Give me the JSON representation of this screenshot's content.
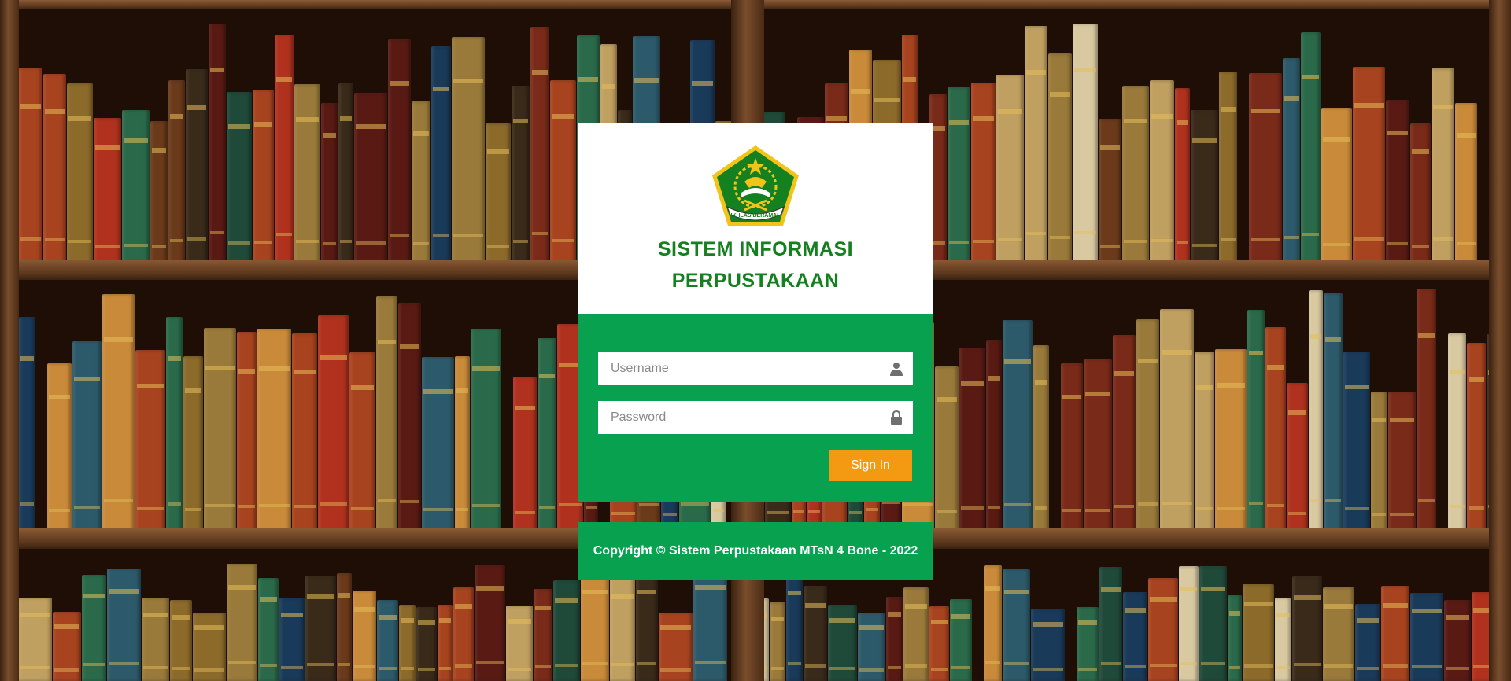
{
  "app": {
    "title_line1": "SISTEM INFORMASI",
    "title_line2": "PERPUSTAKAAN",
    "logo_icon": "kemenag-emblem-icon",
    "logo_text": "IKHLAS BERAMAL"
  },
  "login": {
    "username_placeholder": "Username",
    "username_icon": "user-icon",
    "password_placeholder": "Password",
    "password_icon": "lock-icon",
    "signin_label": "Sign In"
  },
  "footer": {
    "copyright": "Copyright © Sistem Perpustakaan MTsN 4 Bone - 2022"
  },
  "colors": {
    "primary_green": "#07a14f",
    "title_green": "#15801f",
    "button_orange": "#f39a12",
    "card_white": "#ffffff"
  }
}
